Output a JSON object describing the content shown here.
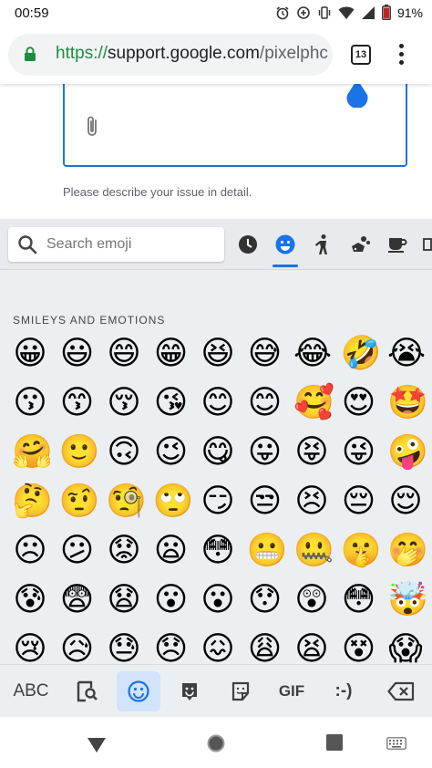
{
  "status": {
    "time": "00:59",
    "battery": "91%",
    "icons": [
      "alarm-icon",
      "data-saver-icon",
      "vibrate-icon",
      "wifi-icon",
      "cell-signal-icon",
      "battery-icon"
    ]
  },
  "browser": {
    "url_scheme": "https://",
    "url_host": "support.google.com",
    "url_path": "/pixelphc",
    "tab_count": "13"
  },
  "page": {
    "helper_text": "Please describe your issue in detail."
  },
  "keyboard": {
    "search_placeholder": "Search emoji",
    "categories": [
      "recent",
      "smileys",
      "people",
      "animals-nature",
      "food-drink",
      "more"
    ],
    "active_category": "smileys",
    "section_title": "SMILEYS AND EMOTIONS",
    "emoji_rows": [
      [
        "😀",
        "😃",
        "😄",
        "😁",
        "😆",
        "😅",
        "😂",
        "🤣",
        "😭"
      ],
      [
        "😗",
        "😙",
        "😚",
        "😘",
        "😊",
        "😊",
        "🥰",
        "😍",
        "🤩"
      ],
      [
        "🤗",
        "🙂",
        "🙃",
        "😉",
        "😋",
        "😛",
        "😝",
        "😜",
        "🤪"
      ],
      [
        "🤔",
        "🤨",
        "🧐",
        "🙄",
        "😏",
        "😒",
        "😣",
        "😔",
        "😌"
      ],
      [
        "☹",
        "😕",
        "😟",
        "😦",
        "😳",
        "😬",
        "🤐",
        "🤫",
        "🤭"
      ],
      [
        "😰",
        "😨",
        "😧",
        "😮",
        "😮",
        "😯",
        "😲",
        "😳",
        "🤯"
      ],
      [
        "😢",
        "😥",
        "😓",
        "😞",
        "😖",
        "😩",
        "😫",
        "😵",
        "😱"
      ]
    ],
    "bottom_bar": {
      "abc_label": "ABC",
      "gif_label": "GIF",
      "emoticon_label": ":-)"
    }
  },
  "colors": {
    "accent": "#1a73e8",
    "secure_green": "#1e8e3e",
    "keyboard_bg": "#eceff1"
  }
}
